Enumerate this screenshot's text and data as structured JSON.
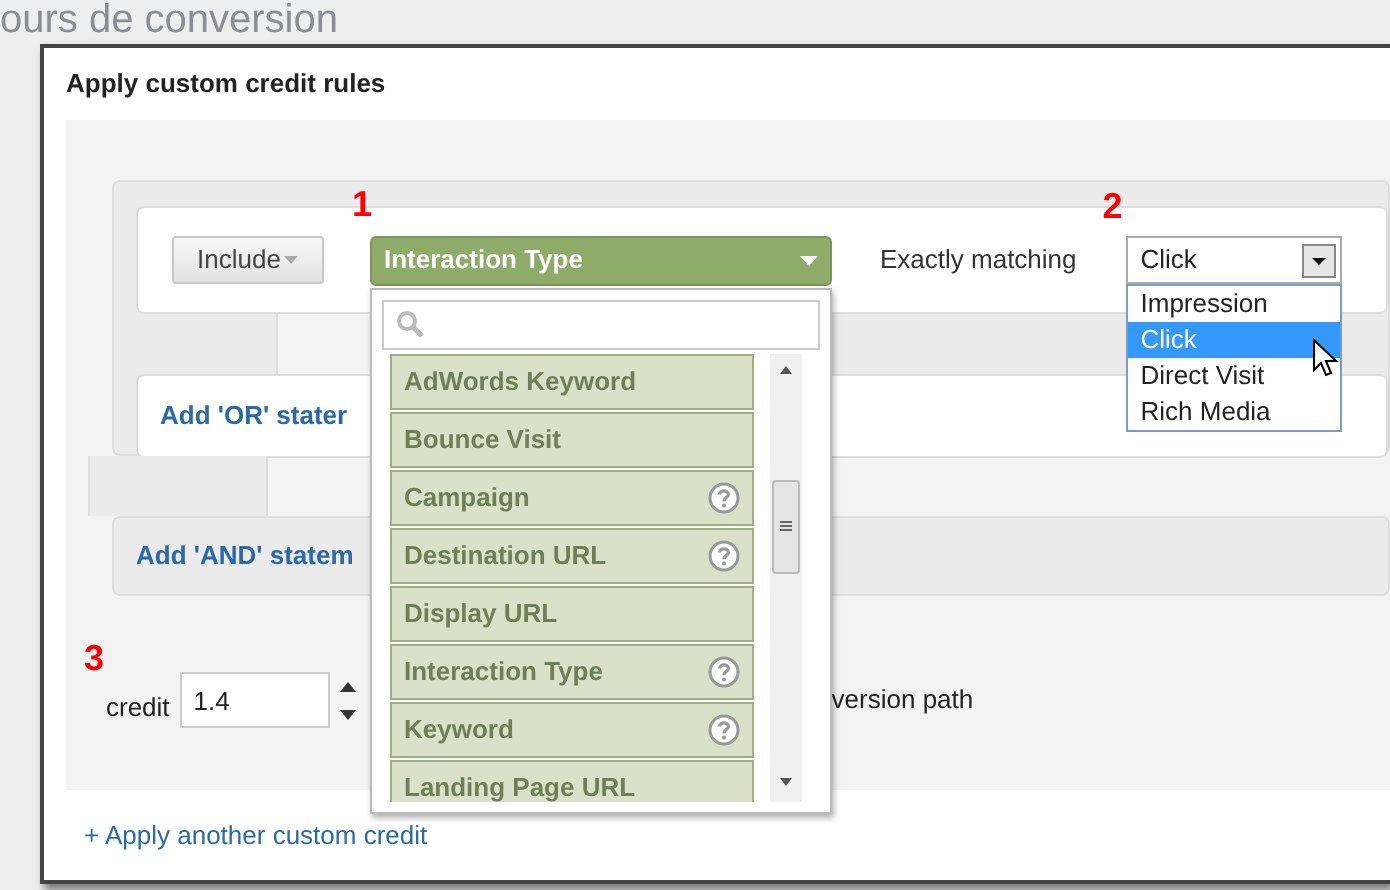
{
  "background_title": "ours de conversion",
  "dialog": {
    "title": "Apply custom credit rules",
    "rule": {
      "include": "Include",
      "dimension": "Interaction Type",
      "operator": "Exactly matching",
      "value": "Click",
      "value_options": [
        {
          "label": "Impression",
          "selected": false
        },
        {
          "label": "Click",
          "selected": true
        },
        {
          "label": "Direct Visit",
          "selected": false
        },
        {
          "label": "Rich Media",
          "selected": false
        }
      ]
    },
    "dimension_menu": {
      "items": [
        {
          "label": "AdWords Keyword",
          "help": false
        },
        {
          "label": "Bounce Visit",
          "help": false
        },
        {
          "label": "Campaign",
          "help": true
        },
        {
          "label": "Destination URL",
          "help": true
        },
        {
          "label": "Display URL",
          "help": false
        },
        {
          "label": "Interaction Type",
          "help": true
        },
        {
          "label": "Keyword",
          "help": true
        },
        {
          "label": "Landing Page URL",
          "help": false
        }
      ]
    },
    "add_or": "Add 'OR' stater",
    "add_and": "Add 'AND' statem",
    "credit": {
      "label": "credit",
      "value": "1.4",
      "suffix": "version path"
    },
    "annotations": [
      "1",
      "2",
      "3"
    ],
    "apply_another": "+ Apply another custom credit"
  }
}
